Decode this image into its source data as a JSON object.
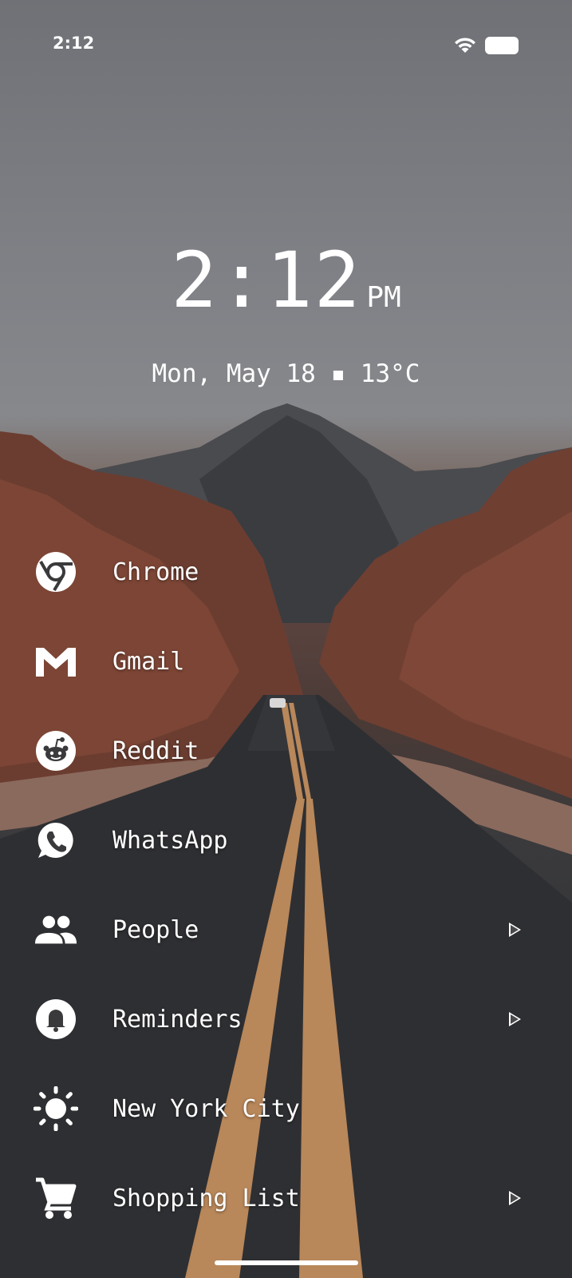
{
  "status_bar": {
    "time": "2:12",
    "wifi_icon": "wifi-icon",
    "battery_icon": "battery-icon"
  },
  "clock": {
    "time": "2:12",
    "ampm": "PM"
  },
  "date_weather": "Mon, May 18 ▪ 13°C",
  "apps": [
    {
      "label": "Chrome",
      "icon": "chrome-icon",
      "has_submenu": false
    },
    {
      "label": "Gmail",
      "icon": "gmail-icon",
      "has_submenu": false
    },
    {
      "label": "Reddit",
      "icon": "reddit-icon",
      "has_submenu": false
    },
    {
      "label": "WhatsApp",
      "icon": "whatsapp-icon",
      "has_submenu": false
    },
    {
      "label": "People",
      "icon": "people-icon",
      "has_submenu": true
    },
    {
      "label": "Reminders",
      "icon": "bell-icon",
      "has_submenu": true
    },
    {
      "label": "New York City",
      "icon": "sun-icon",
      "has_submenu": false
    },
    {
      "label": "Shopping List",
      "icon": "cart-icon",
      "has_submenu": true
    }
  ]
}
